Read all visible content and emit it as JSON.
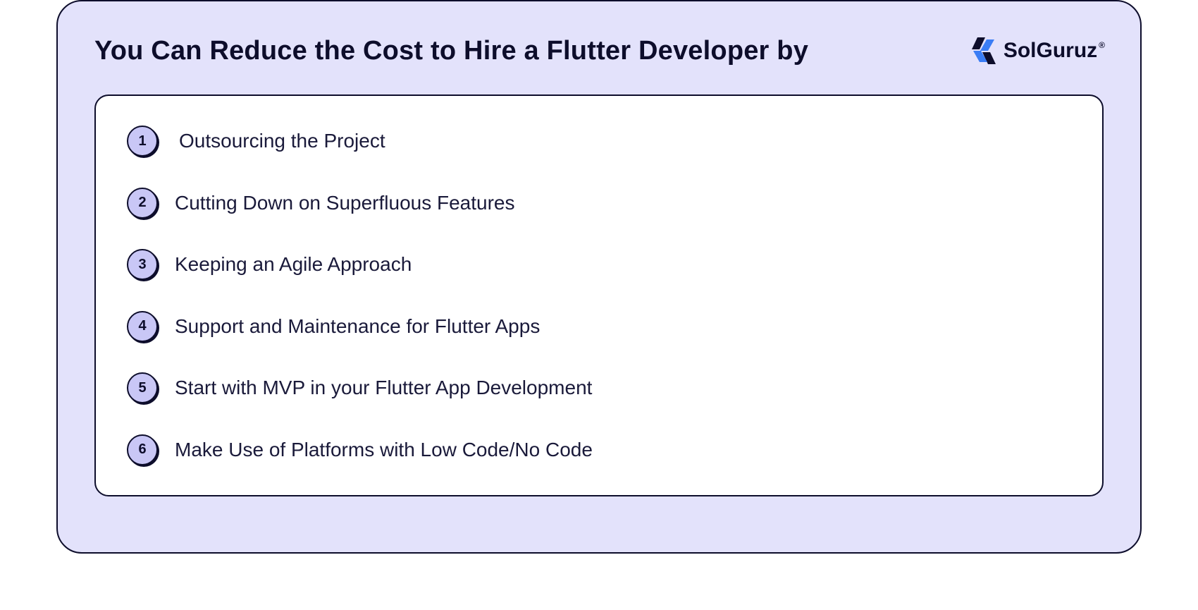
{
  "title": "You Can Reduce the Cost to Hire a Flutter Developer by",
  "logo": {
    "name": "SolGuruz",
    "registered": "®"
  },
  "items": [
    {
      "num": "1",
      "text": "Outsourcing the Project"
    },
    {
      "num": "2",
      "text": "Cutting Down on Superfluous Features"
    },
    {
      "num": "3",
      "text": "Keeping an Agile Approach"
    },
    {
      "num": "4",
      "text": "Support and Maintenance for Flutter Apps"
    },
    {
      "num": "5",
      "text": "Start with MVP in your Flutter App Development"
    },
    {
      "num": "6",
      "text": "Make Use of Platforms with Low Code/No Code"
    }
  ]
}
